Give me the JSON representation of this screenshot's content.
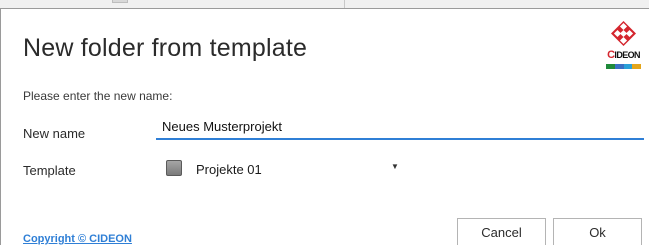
{
  "dialog": {
    "title": "New folder from template",
    "prompt": "Please enter the new name:"
  },
  "brand": {
    "logo_text": "CIDEON",
    "logo_initial": "C",
    "logo_rest": "IDEON",
    "accent_color": "#d4262e",
    "bar_colors": [
      "#1f8a3a",
      "#3a6fc4",
      "#2aa0d8",
      "#e3a51b"
    ]
  },
  "form": {
    "name_label": "New name",
    "name_value": "Neues Musterprojekt",
    "template_label": "Template",
    "template_value": "Projekte 01",
    "template_icon": "folder-icon"
  },
  "footer": {
    "copyright": "Copyright © CIDEON",
    "cancel_label": "Cancel",
    "ok_label": "Ok"
  },
  "colors": {
    "link": "#2f7fd6",
    "input_underline": "#2f7fd6"
  }
}
